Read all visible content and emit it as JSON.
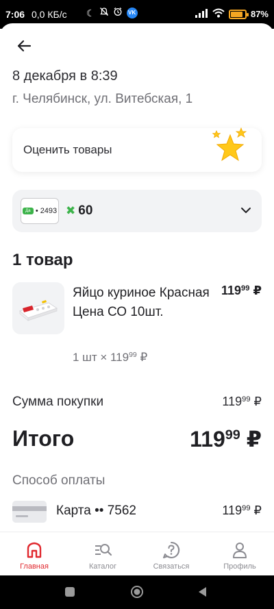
{
  "status_bar": {
    "time": "7:06",
    "network": "0,0 КБ/с",
    "vk_badge": "VK",
    "battery_percent": "87%",
    "battery_level": 0.87,
    "battery_color": "#f5a623"
  },
  "order": {
    "date": "8 декабря в 8:39",
    "address": "г. Челябинск, ул. Витебская, 1"
  },
  "rate_card": {
    "label": "Оценить товары"
  },
  "bonus": {
    "card_number": "2493",
    "card_logo": "Да",
    "points": "60",
    "accent": "#3cb34a"
  },
  "items": {
    "title": "1 товар",
    "list": [
      {
        "name": "Яйцо куриное Красная Цена СО 10шт.",
        "price_rub": "119",
        "price_kop": "99",
        "currency": "₽",
        "qty_prefix": "1 шт × 119",
        "qty_kop": "99",
        "qty_currency": "₽"
      }
    ]
  },
  "summary": {
    "sum_label": "Сумма покупки",
    "sum_rub": "119",
    "sum_kop": "99",
    "total_label": "Итого",
    "total_rub": "119",
    "total_kop": "99",
    "currency": "₽"
  },
  "payment": {
    "title": "Способ оплаты",
    "method": "Карта •• 7562",
    "amount_rub": "119",
    "amount_kop": "99",
    "currency": "₽"
  },
  "bottom_nav": {
    "items": [
      {
        "label": "Главная",
        "icon": "home-icon"
      },
      {
        "label": "Каталог",
        "icon": "catalog-search-icon"
      },
      {
        "label": "Связаться",
        "icon": "help-icon"
      },
      {
        "label": "Профиль",
        "icon": "profile-icon"
      }
    ],
    "active_color": "#e0282e",
    "inactive_color": "#8b8b91"
  }
}
